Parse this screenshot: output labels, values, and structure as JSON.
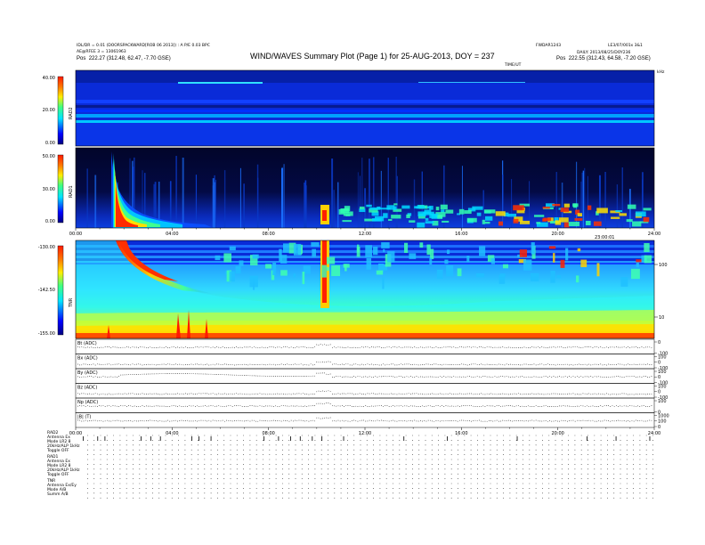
{
  "header": {
    "left_line1": "IDL/DR = 0.01 (DOORSPACKWARD[ROB 06 2013]) : A P/E 0.03 BPC",
    "left_line2": "AE@RFEE 3 = 13061963",
    "left_pos_label": "Pos",
    "left_pos_value": "222.27 (312.48, 62.47, -7.70 GSE)",
    "title": "WIND/WAVES Summary Plot (Page 1) for 25-AUG-2013, DOY = 237",
    "right_top_a": "FWDAR1243",
    "right_top_b": "LE3/07/001x 3&1",
    "right_line2": "DAILY: 2013/08/25/DOY236",
    "right_pos_label": "Pos",
    "right_pos_value": "222.55 (312.43, 64.58, -7.20 GSE)",
    "time_label": "TIME/UT",
    "kh_label": "kHz"
  },
  "colors": {
    "background": "#ffffff",
    "panel_dark_blue": "#06106e",
    "panel_blue": "#0a2bd8",
    "cyan": "#00e5ff",
    "yellow": "#ffee00",
    "red": "#ff1a00"
  },
  "chart_data": [
    {
      "type": "heatmap",
      "panel": "RAD2",
      "ylabel": "RAD2",
      "colorbar_ticks": [
        "40.00",
        "20.00",
        "0.00"
      ],
      "clim": [
        0,
        40
      ],
      "note_visible": "uniform background with horizontal bands"
    },
    {
      "type": "heatmap",
      "panel": "RAD1",
      "ylabel": "RAD1",
      "colorbar_ticks": [
        "50.00",
        "30.00",
        "0.00"
      ],
      "clim": [
        0,
        50
      ],
      "x_ticks": [
        "00:00",
        "04:00",
        "08:00",
        "12:00",
        "16:00",
        "20:00",
        "24:00"
      ],
      "xlim": [
        0,
        24
      ]
    },
    {
      "type": "heatmap",
      "panel": "TNR",
      "ylabel": "TNR",
      "colorbar_ticks": [
        "-130.00",
        "-142.50",
        "-155.00"
      ],
      "clim": [
        -155,
        -130
      ],
      "right_axis_ticks": [
        "100",
        "10"
      ],
      "x_label": "23:00:01"
    },
    {
      "type": "line",
      "panel": "magnetometer",
      "rows": [
        {
          "label": "Bt (ADC)",
          "right_ticks": [
            "0",
            "-100"
          ]
        },
        {
          "label": "Bx (ADC)",
          "right_ticks": [
            "100",
            "0",
            "-100"
          ]
        },
        {
          "label": "By (ADC)",
          "right_ticks": [
            "100",
            "0",
            "-100"
          ]
        },
        {
          "label": "Bz (ADC)",
          "right_ticks": [
            "100",
            "0",
            "-100"
          ]
        },
        {
          "label": "Np (ADC)",
          "right_ticks": [
            "100",
            "0"
          ]
        },
        {
          "label": "|B| (T)",
          "right_ticks": [
            "1000",
            "100",
            "0"
          ]
        }
      ],
      "x_ticks": [
        "00:00",
        "04:00",
        "08:00",
        "12:00",
        "16:00",
        "20:00",
        "24:00"
      ],
      "xlim": [
        0,
        24
      ]
    }
  ],
  "footer": {
    "rad2_header": "RAD2",
    "rad2_rows": [
      "Antenna     Ex",
      "Mode   LR2 8",
      "20kHz/ALP 1kHz",
      "Toggle     OFF"
    ],
    "rad1_header": "RAD1",
    "rad1_rows": [
      "Antenna     Ex",
      "Mode   LR2 8",
      "20kHz/ALP 1kHz",
      "Toggle     OFF"
    ],
    "tnr_header": "TNR",
    "tnr_rows": [
      "Antenna   Ex/Ey",
      "Mode       A/B",
      "Summ     A/B"
    ]
  }
}
